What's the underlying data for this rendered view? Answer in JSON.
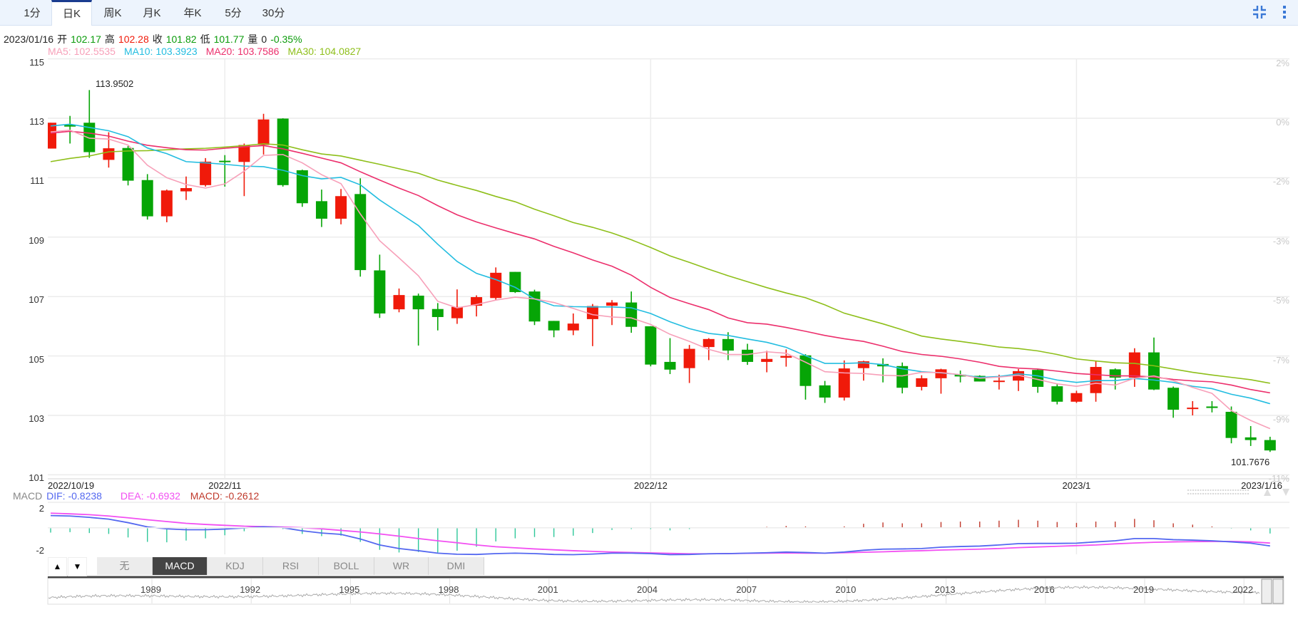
{
  "period_tabs": [
    {
      "label": "1分",
      "active": false
    },
    {
      "label": "日K",
      "active": true
    },
    {
      "label": "周K",
      "active": false
    },
    {
      "label": "月K",
      "active": false
    },
    {
      "label": "年K",
      "active": false
    },
    {
      "label": "5分",
      "active": false
    },
    {
      "label": "30分",
      "active": false
    }
  ],
  "toolbar_icons": [
    "compress-icon",
    "more-vertical-icon"
  ],
  "quote": {
    "date": "2023/01/16",
    "open_label": "开",
    "open": "102.17",
    "high_label": "高",
    "high": "102.28",
    "close_label": "收",
    "close": "101.82",
    "low_label": "低",
    "low": "101.77",
    "volume_label": "量",
    "volume": "0",
    "change": "-0.35%"
  },
  "ma_legend": {
    "ma5": "MA5: 102.5535",
    "ma10": "MA10: 103.3923",
    "ma20": "MA20: 103.7586",
    "ma30": "MA30: 104.0827"
  },
  "colors": {
    "up": "#f01a0a",
    "down": "#06a506",
    "ma5": "#f7a0b9",
    "ma10": "#23bde0",
    "ma20": "#ec2f6c",
    "ma30": "#8ebf1a",
    "dif": "#5468f0",
    "dea": "#f24ff2",
    "macd": "#c0392b",
    "accent": "#1a3c8f"
  },
  "chart_data": {
    "type": "candlestick",
    "ylim": [
      101,
      115
    ],
    "y_ticks": [
      "115",
      "113",
      "111",
      "109",
      "107",
      "105",
      "103",
      "101"
    ],
    "y_tick_values": [
      115,
      113,
      111,
      109,
      107,
      105,
      103,
      101
    ],
    "y_right_ticks": [
      "2%",
      "0%",
      "-2%",
      "-3%",
      "-5%",
      "-7%",
      "-9%",
      "-11%"
    ],
    "x_labels": [
      {
        "label": "2022/10/19",
        "index": 0
      },
      {
        "label": "2022/11",
        "index": 9
      },
      {
        "label": "2022/12",
        "index": 31
      },
      {
        "label": "2023/1",
        "index": 53
      },
      {
        "label": "2023/1/16",
        "index": 63
      }
    ],
    "grid": true,
    "max_label": "113.9502",
    "min_label": "101.7676",
    "ohlc": [
      [
        111.98,
        112.85,
        111.98,
        112.85
      ],
      [
        112.78,
        113.08,
        112.15,
        112.72
      ],
      [
        112.85,
        113.95,
        111.67,
        111.86
      ],
      [
        111.6,
        112.53,
        111.34,
        111.99
      ],
      [
        112.0,
        112.07,
        110.74,
        110.9
      ],
      [
        110.92,
        111.12,
        109.59,
        109.7
      ],
      [
        109.7,
        110.6,
        109.5,
        110.57
      ],
      [
        110.54,
        111.04,
        110.25,
        110.65
      ],
      [
        110.75,
        111.66,
        110.7,
        111.54
      ],
      [
        111.57,
        111.76,
        110.7,
        111.53
      ],
      [
        111.53,
        112.15,
        110.38,
        112.1
      ],
      [
        112.1,
        113.15,
        111.78,
        112.96
      ],
      [
        112.99,
        113.0,
        110.7,
        110.75
      ],
      [
        111.25,
        111.27,
        110.02,
        110.14
      ],
      [
        110.21,
        110.6,
        109.34,
        109.62
      ],
      [
        109.62,
        110.62,
        109.43,
        110.38
      ],
      [
        110.45,
        110.98,
        107.67,
        107.89
      ],
      [
        107.88,
        108.41,
        106.28,
        106.43
      ],
      [
        106.57,
        107.27,
        106.47,
        107.05
      ],
      [
        107.03,
        107.1,
        105.35,
        106.57
      ],
      [
        106.58,
        106.78,
        105.86,
        106.31
      ],
      [
        106.27,
        107.24,
        106.08,
        106.65
      ],
      [
        106.69,
        107.04,
        106.33,
        106.98
      ],
      [
        106.95,
        107.98,
        106.87,
        107.8
      ],
      [
        107.83,
        107.83,
        107.12,
        107.15
      ],
      [
        107.17,
        107.23,
        106.04,
        106.16
      ],
      [
        106.18,
        106.18,
        105.63,
        105.86
      ],
      [
        105.86,
        106.43,
        105.7,
        106.09
      ],
      [
        106.24,
        106.75,
        105.33,
        106.68
      ],
      [
        106.69,
        106.88,
        106.04,
        106.8
      ],
      [
        106.8,
        107.17,
        105.78,
        105.98
      ],
      [
        106.0,
        106.0,
        104.65,
        104.71
      ],
      [
        104.8,
        105.6,
        104.39,
        104.54
      ],
      [
        104.59,
        105.37,
        104.09,
        105.24
      ],
      [
        105.3,
        105.6,
        104.86,
        105.57
      ],
      [
        105.57,
        105.8,
        104.86,
        105.18
      ],
      [
        105.21,
        105.41,
        104.7,
        104.8
      ],
      [
        104.8,
        105.17,
        104.45,
        104.9
      ],
      [
        104.94,
        105.22,
        104.64,
        105.0
      ],
      [
        105.02,
        105.06,
        103.53,
        103.99
      ],
      [
        104.01,
        104.16,
        103.42,
        103.6
      ],
      [
        103.6,
        104.85,
        103.5,
        104.58
      ],
      [
        104.59,
        104.84,
        104.17,
        104.82
      ],
      [
        104.73,
        104.92,
        104.11,
        104.65
      ],
      [
        104.66,
        104.78,
        103.74,
        103.93
      ],
      [
        103.96,
        104.35,
        103.84,
        104.25
      ],
      [
        104.25,
        104.57,
        103.73,
        104.55
      ],
      [
        104.37,
        104.51,
        104.11,
        104.31
      ],
      [
        104.33,
        104.35,
        104.14,
        104.14
      ],
      [
        104.15,
        104.37,
        103.87,
        104.17
      ],
      [
        104.17,
        104.56,
        103.82,
        104.49
      ],
      [
        104.53,
        104.56,
        103.76,
        103.96
      ],
      [
        103.98,
        104.08,
        103.37,
        103.46
      ],
      [
        103.46,
        103.83,
        103.42,
        103.75
      ],
      [
        103.75,
        104.83,
        103.46,
        104.63
      ],
      [
        104.55,
        104.58,
        103.87,
        104.27
      ],
      [
        104.27,
        105.26,
        103.96,
        105.12
      ],
      [
        105.12,
        105.62,
        103.85,
        103.87
      ],
      [
        103.93,
        103.97,
        102.92,
        103.19
      ],
      [
        103.22,
        103.48,
        103.0,
        103.26
      ],
      [
        103.3,
        103.48,
        103.1,
        103.25
      ],
      [
        103.12,
        103.3,
        102.06,
        102.24
      ],
      [
        102.26,
        102.64,
        101.97,
        102.17
      ],
      [
        102.17,
        102.28,
        101.77,
        101.82
      ]
    ],
    "ma": {
      "ma5": [
        112.54,
        112.6,
        112.33,
        112.3,
        112.1,
        111.42,
        111.0,
        110.77,
        110.65,
        110.79,
        111.22,
        111.75,
        111.78,
        111.5,
        111.1,
        110.8,
        109.78,
        108.88,
        108.3,
        107.7,
        106.84,
        106.62,
        106.73,
        106.88,
        106.98,
        106.92,
        106.8,
        106.6,
        106.39,
        106.31,
        106.28,
        106.06,
        105.73,
        105.49,
        105.22,
        105.05,
        105.05,
        105.14,
        105.09,
        104.79,
        104.47,
        104.43,
        104.41,
        104.35,
        104.33,
        104.45,
        104.44,
        104.37,
        104.25,
        104.29,
        104.35,
        104.21,
        104.06,
        103.98,
        104.08,
        104.02,
        104.25,
        104.33,
        104.17,
        103.94,
        103.74,
        103.16,
        102.83,
        102.5535
      ],
      "ma10": [
        112.74,
        112.8,
        112.69,
        112.58,
        112.38,
        112.0,
        111.81,
        111.54,
        111.5,
        111.45,
        111.39,
        111.37,
        111.25,
        111.07,
        110.96,
        111.01,
        110.76,
        110.25,
        109.82,
        109.39,
        108.76,
        108.18,
        107.78,
        107.57,
        107.31,
        106.92,
        106.69,
        106.66,
        106.65,
        106.65,
        106.62,
        106.43,
        106.15,
        105.92,
        105.76,
        105.69,
        105.57,
        105.46,
        105.29,
        105.01,
        104.75,
        104.75,
        104.77,
        104.71,
        104.57,
        104.47,
        104.43,
        104.37,
        104.28,
        104.31,
        104.4,
        104.33,
        104.19,
        104.11,
        104.17,
        104.17,
        104.24,
        104.19,
        104.11,
        103.98,
        103.9,
        103.71,
        103.58,
        103.3923
      ],
      "ma20": [
        112.5,
        112.56,
        112.5,
        112.4,
        112.23,
        112.09,
        112.01,
        111.94,
        111.93,
        111.99,
        112.04,
        112.08,
        111.97,
        111.82,
        111.66,
        111.5,
        111.2,
        110.92,
        110.65,
        110.4,
        110.06,
        109.75,
        109.51,
        109.31,
        109.12,
        108.94,
        108.69,
        108.47,
        108.23,
        108.02,
        107.72,
        107.31,
        106.97,
        106.76,
        106.56,
        106.28,
        106.12,
        106.07,
        105.96,
        105.83,
        105.69,
        105.58,
        105.49,
        105.33,
        105.15,
        105.05,
        104.99,
        104.9,
        104.79,
        104.65,
        104.59,
        104.56,
        104.49,
        104.41,
        104.37,
        104.33,
        104.33,
        104.29,
        104.21,
        104.16,
        104.13,
        104.02,
        103.87,
        103.7586
      ],
      "ma30": [
        111.54,
        111.65,
        111.73,
        111.87,
        111.9,
        111.91,
        111.94,
        111.97,
        111.99,
        112.03,
        112.08,
        112.14,
        112.1,
        111.94,
        111.8,
        111.73,
        111.59,
        111.45,
        111.3,
        111.15,
        110.92,
        110.74,
        110.57,
        110.37,
        110.19,
        109.94,
        109.72,
        109.49,
        109.33,
        109.14,
        108.91,
        108.65,
        108.37,
        108.15,
        107.92,
        107.7,
        107.5,
        107.3,
        107.12,
        106.96,
        106.72,
        106.44,
        106.26,
        106.08,
        105.88,
        105.67,
        105.57,
        105.49,
        105.4,
        105.3,
        105.25,
        105.17,
        105.05,
        104.9,
        104.83,
        104.77,
        104.75,
        104.67,
        104.56,
        104.45,
        104.36,
        104.28,
        104.2,
        104.0827
      ]
    },
    "macd_panel": {
      "title": "MACD",
      "dif_label": "DIF: -0.8238",
      "dea_label": "DEA: -0.6932",
      "macd_label": "MACD: -0.2612",
      "y_ticks": [
        "2",
        "-2"
      ],
      "dif": [
        0.55,
        0.53,
        0.47,
        0.39,
        0.23,
        0.04,
        -0.05,
        -0.09,
        -0.09,
        -0.06,
        -0.01,
        0.04,
        0,
        -0.14,
        -0.24,
        -0.3,
        -0.51,
        -0.78,
        -0.94,
        -1.04,
        -1.15,
        -1.2,
        -1.21,
        -1.17,
        -1.15,
        -1.17,
        -1.21,
        -1.22,
        -1.19,
        -1.15,
        -1.15,
        -1.17,
        -1.22,
        -1.21,
        -1.18,
        -1.17,
        -1.15,
        -1.13,
        -1.1,
        -1.12,
        -1.15,
        -1.1,
        -1.02,
        -0.97,
        -0.96,
        -0.94,
        -0.88,
        -0.85,
        -0.83,
        -0.78,
        -0.72,
        -0.71,
        -0.71,
        -0.7,
        -0.64,
        -0.59,
        -0.49,
        -0.49,
        -0.54,
        -0.56,
        -0.59,
        -0.64,
        -0.7,
        -0.8238
      ],
      "dea": [
        0.66,
        0.63,
        0.59,
        0.53,
        0.45,
        0.36,
        0.28,
        0.2,
        0.15,
        0.11,
        0.07,
        0.05,
        0.03,
        0,
        -0.05,
        -0.12,
        -0.19,
        -0.28,
        -0.38,
        -0.49,
        -0.59,
        -0.68,
        -0.78,
        -0.86,
        -0.91,
        -0.96,
        -1.0,
        -1.04,
        -1.07,
        -1.1,
        -1.12,
        -1.14,
        -1.16,
        -1.18,
        -1.18,
        -1.17,
        -1.16,
        -1.15,
        -1.14,
        -1.15,
        -1.15,
        -1.13,
        -1.11,
        -1.09,
        -1.06,
        -1.04,
        -1.01,
        -0.99,
        -0.97,
        -0.94,
        -0.9,
        -0.87,
        -0.84,
        -0.81,
        -0.78,
        -0.73,
        -0.69,
        -0.66,
        -0.64,
        -0.63,
        -0.62,
        -0.62,
        -0.64,
        -0.6932
      ],
      "macd": [
        -0.22,
        -0.2,
        -0.24,
        -0.28,
        -0.44,
        -0.64,
        -0.66,
        -0.58,
        -0.48,
        -0.34,
        -0.16,
        -0.02,
        -0.06,
        -0.28,
        -0.38,
        -0.36,
        -0.64,
        -1.0,
        -1.12,
        -1.1,
        -1.12,
        -1.04,
        -0.86,
        -0.62,
        -0.48,
        -0.42,
        -0.42,
        -0.36,
        -0.24,
        -0.1,
        -0.06,
        -0.06,
        -0.12,
        -0.06,
        0,
        0,
        0.02,
        0.04,
        0.08,
        0.06,
        0,
        0.06,
        0.18,
        0.24,
        0.2,
        0.2,
        0.26,
        0.28,
        0.28,
        0.32,
        0.36,
        0.32,
        0.26,
        0.22,
        0.28,
        0.28,
        0.4,
        0.34,
        0.2,
        0.14,
        0.06,
        -0.04,
        -0.12,
        -0.2612
      ]
    }
  },
  "indicator_tabs": [
    {
      "label": "无",
      "active": false
    },
    {
      "label": "MACD",
      "active": true
    },
    {
      "label": "KDJ",
      "active": false
    },
    {
      "label": "RSI",
      "active": false
    },
    {
      "label": "BOLL",
      "active": false
    },
    {
      "label": "WR",
      "active": false
    },
    {
      "label": "DMI",
      "active": false
    }
  ],
  "panel_arrows": {
    "up": "▲",
    "down": "▼"
  },
  "navigator": {
    "years": [
      "1989",
      "1992",
      "1995",
      "1998",
      "2001",
      "2004",
      "2007",
      "2010",
      "2013",
      "2016",
      "2019",
      "2022"
    ]
  }
}
